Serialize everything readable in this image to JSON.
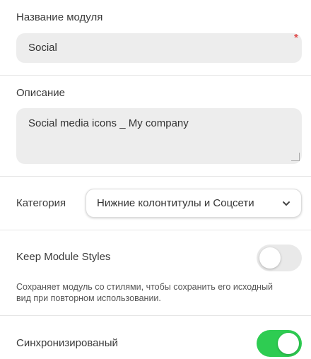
{
  "module_name": {
    "label": "Название модуля",
    "value": "Social",
    "required_mark": "*"
  },
  "description": {
    "label": "Описание",
    "value": "Social media icons _ My company"
  },
  "category": {
    "label": "Категория",
    "selected": "Нижние колонтитулы и Соцсети",
    "icon": "chevron-down-icon"
  },
  "keep_styles": {
    "label": "Keep Module Styles",
    "enabled": false,
    "help_text": "Сохраняет модуль со стилями, чтобы сохранить его исходный вид при повторном использовании."
  },
  "synchronized": {
    "label": "Синхронизированый",
    "enabled": true
  },
  "colors": {
    "toggle_on": "#2ecc52",
    "toggle_off": "#e9e9e9",
    "input_bg": "#ededed",
    "required": "#e14c4c"
  }
}
